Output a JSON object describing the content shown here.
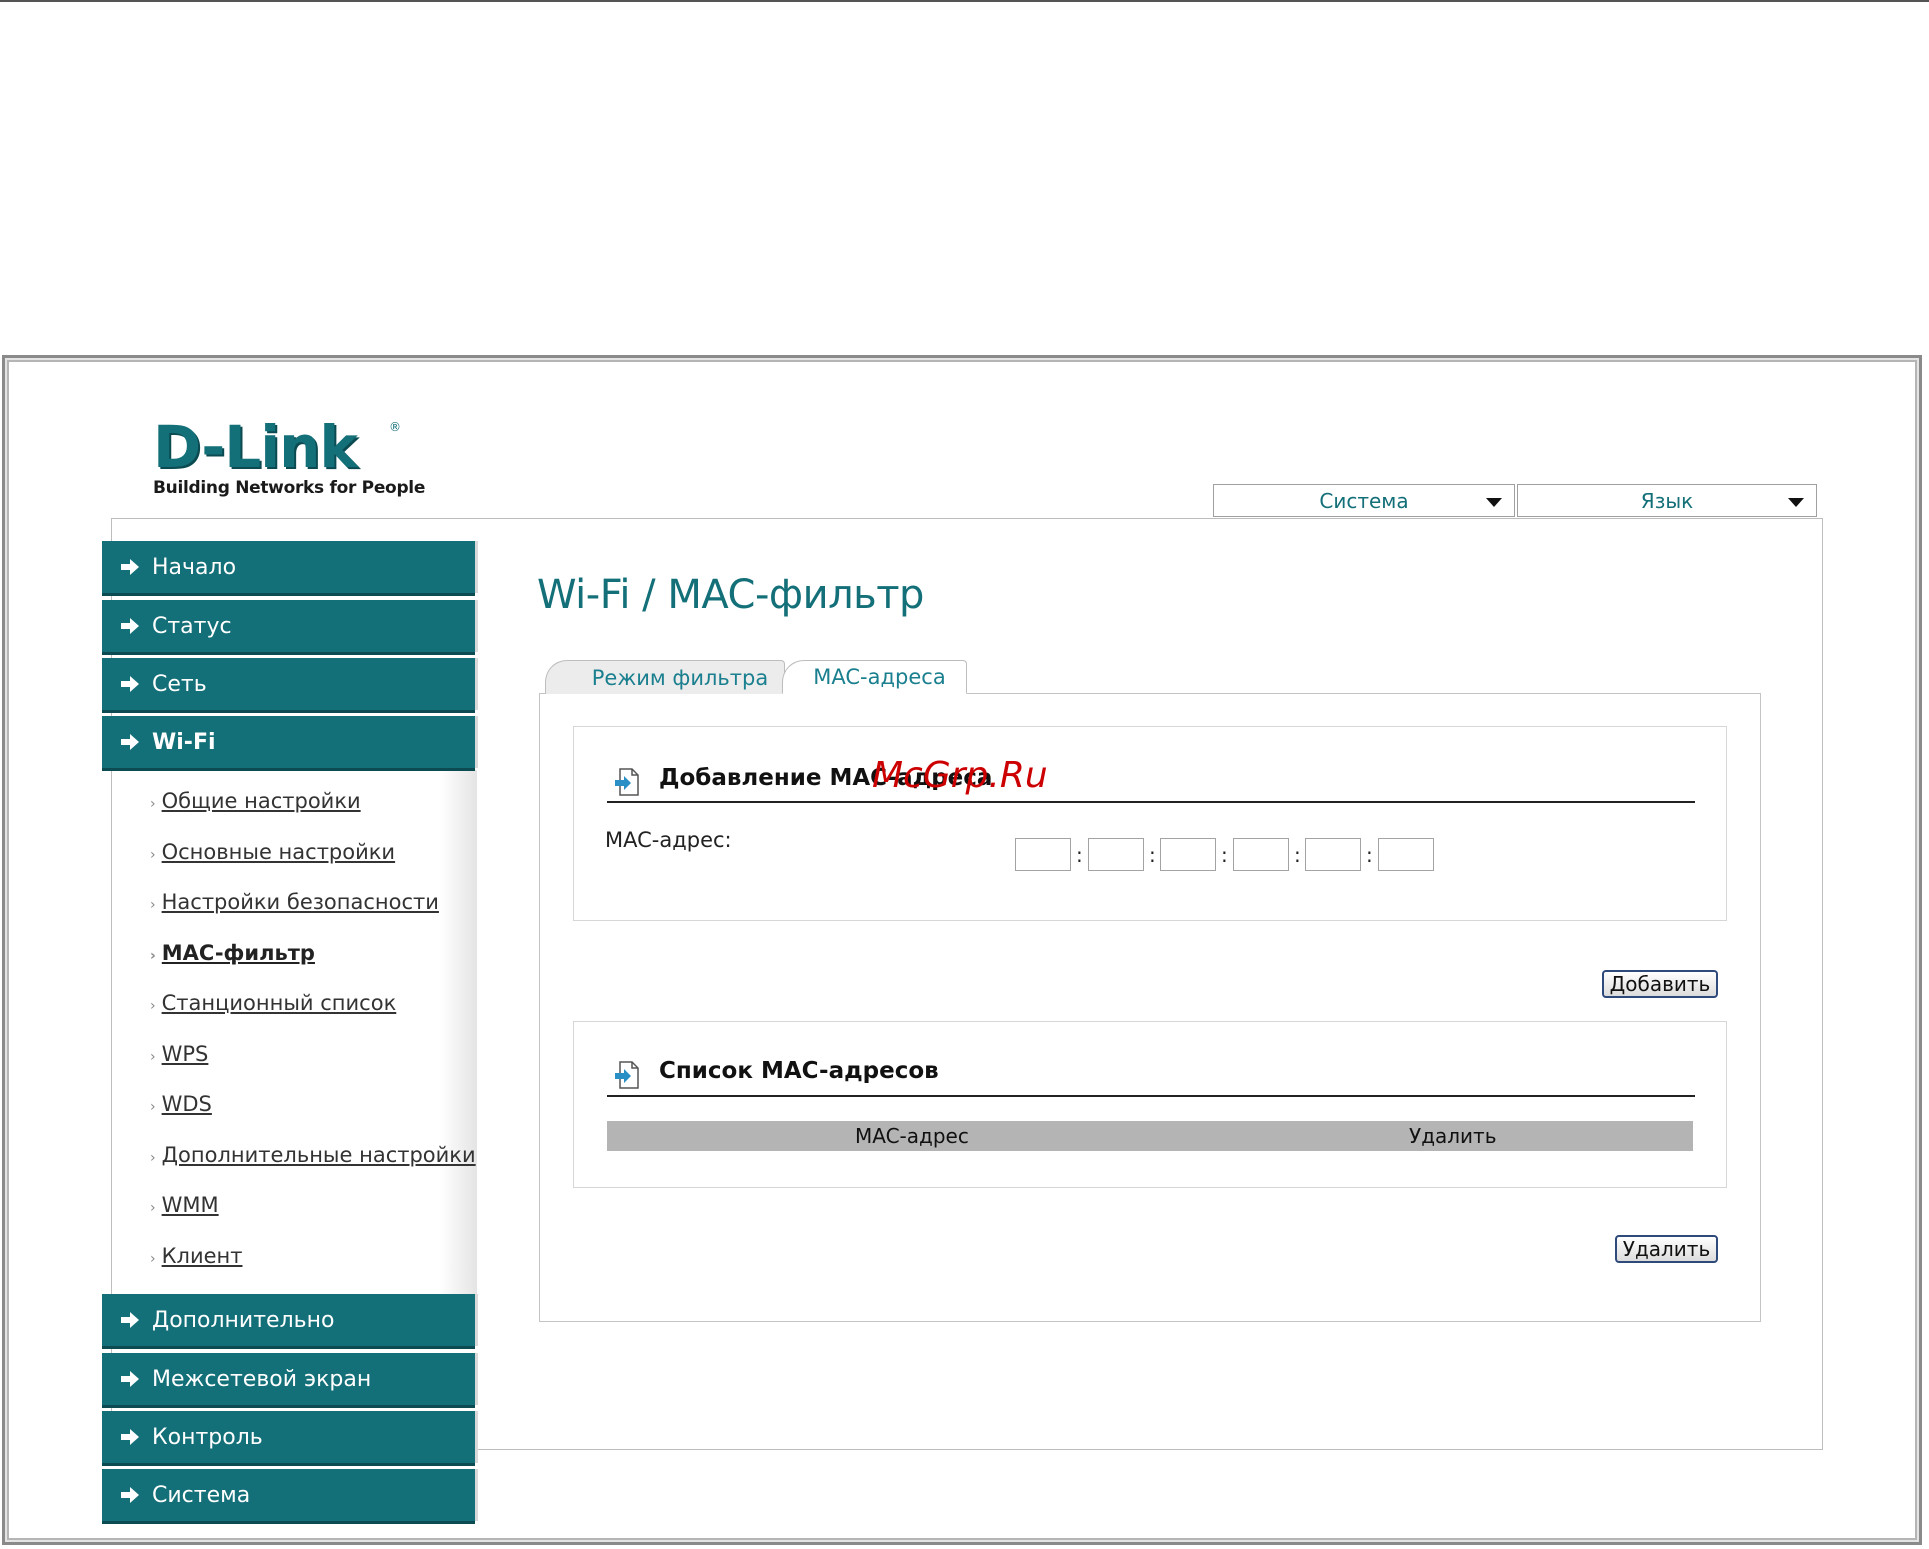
{
  "logo": {
    "word": "D-Link",
    "registered": "®",
    "tagline": "Building Networks for People"
  },
  "header": {
    "system_dropdown": "Система",
    "language_dropdown": "Язык"
  },
  "sidebar": {
    "items": [
      {
        "label": "Начало"
      },
      {
        "label": "Статус"
      },
      {
        "label": "Сеть"
      },
      {
        "label": "Wi-Fi"
      },
      {
        "label": "Дополнительно"
      },
      {
        "label": "Межсетевой экран"
      },
      {
        "label": "Контроль"
      },
      {
        "label": "Система"
      }
    ],
    "wifi_subitems": [
      {
        "label": "Общие настройки"
      },
      {
        "label": "Основные настройки"
      },
      {
        "label": "Настройки безопасности"
      },
      {
        "label": "MAC-фильтр"
      },
      {
        "label": "Станционный список"
      },
      {
        "label": "WPS"
      },
      {
        "label": "WDS"
      },
      {
        "label": "Дополнительные настройки"
      },
      {
        "label": "WMM"
      },
      {
        "label": "Клиент"
      }
    ]
  },
  "main": {
    "title": "Wi-Fi /  MAC-фильтр",
    "tabs": [
      {
        "label": "Режим фильтра"
      },
      {
        "label": "MAC-адреса"
      }
    ],
    "add_section": {
      "title": "Добавление MAC-адреса",
      "mac_label": "MAC-адрес:",
      "mac_values": [
        "",
        "",
        "",
        "",
        "",
        ""
      ],
      "separator": ":",
      "add_button": "Добавить"
    },
    "list_section": {
      "title": "Список MAC-адресов",
      "columns": [
        "MAC-адрес",
        "Удалить"
      ],
      "delete_button": "Удалить"
    }
  },
  "watermark": "McGrp.Ru",
  "colors": {
    "brand": "#136f78",
    "nav_bg": "#136f78",
    "table_header": "#b4b4b4"
  }
}
